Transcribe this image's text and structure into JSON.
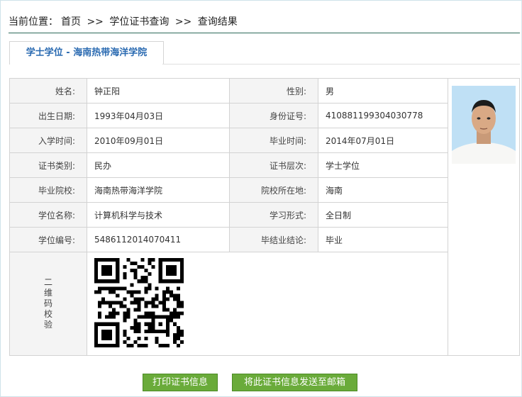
{
  "breadcrumb": {
    "prefix": "当前位置：",
    "items": [
      "首页",
      "学位证书查询",
      "查询结果"
    ],
    "separator": ">>"
  },
  "tab": {
    "label": "学士学位 - 海南热带海洋学院"
  },
  "record": {
    "name": {
      "label": "姓名:",
      "value": "钟正阳"
    },
    "gender": {
      "label": "性别:",
      "value": "男"
    },
    "birth": {
      "label": "出生日期:",
      "value": "1993年04月03日"
    },
    "id_no": {
      "label": "身份证号:",
      "value": "410881199304030778"
    },
    "enroll": {
      "label": "入学时间:",
      "value": "2010年09月01日"
    },
    "graduate": {
      "label": "毕业时间:",
      "value": "2014年07月01日"
    },
    "cert_type": {
      "label": "证书类别:",
      "value": "民办"
    },
    "cert_level": {
      "label": "证书层次:",
      "value": "学士学位"
    },
    "school": {
      "label": "毕业院校:",
      "value": "海南热带海洋学院"
    },
    "location": {
      "label": "院校所在地:",
      "value": "海南"
    },
    "degree": {
      "label": "学位名称:",
      "value": "计算机科学与技术"
    },
    "study_form": {
      "label": "学习形式:",
      "value": "全日制"
    },
    "degree_no": {
      "label": "学位编号:",
      "value": "5486112014070411"
    },
    "conclusion": {
      "label": "毕结业结论:",
      "value": "毕业"
    },
    "qr_label": "二维码校验"
  },
  "buttons": {
    "print": "打印证书信息",
    "email": "将此证书信息发送至邮箱"
  },
  "colors": {
    "tab_text": "#2a6ab1",
    "button_bg": "#6aab3a",
    "rule": "#2d6a5a"
  }
}
